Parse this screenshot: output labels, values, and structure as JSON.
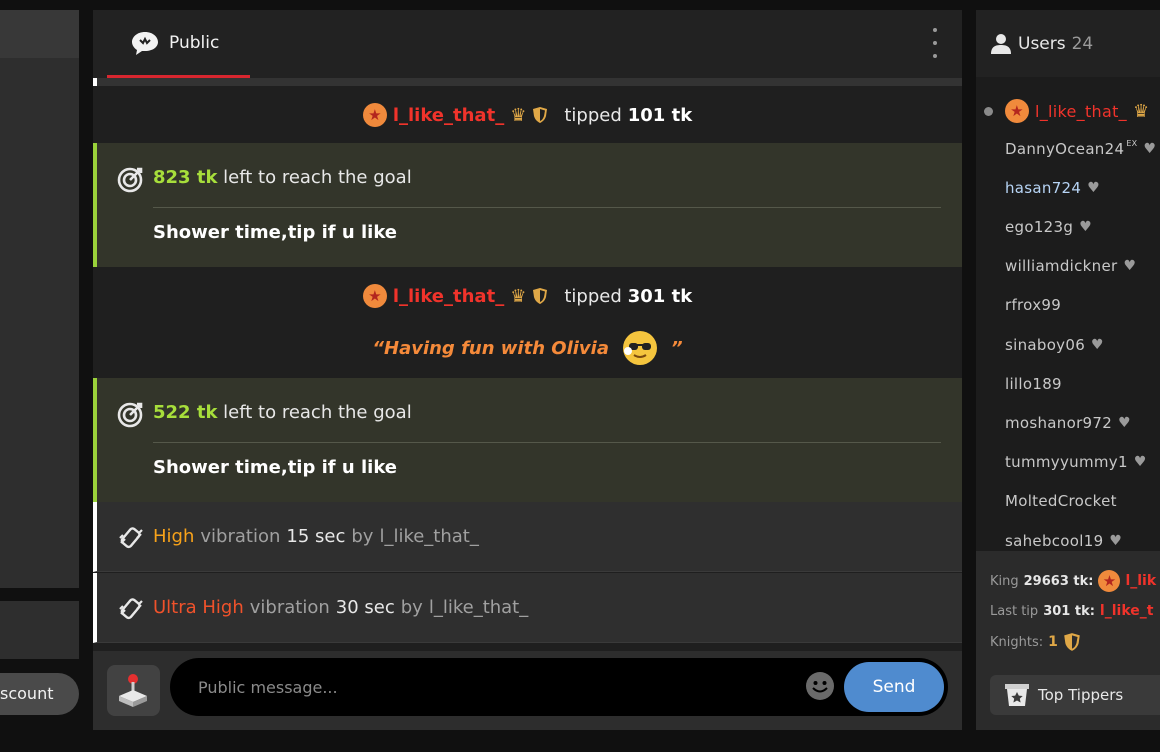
{
  "left": {
    "discount_label": "scount"
  },
  "chat": {
    "tab_label": "Public",
    "messages": {
      "tip1": {
        "user": "l_like_that_",
        "word": "tipped",
        "amount": "101 tk"
      },
      "goal1": {
        "amount": "823 tk",
        "text": "left to reach the goal",
        "subject": "Shower time,tip if u like"
      },
      "tip2": {
        "user": "l_like_that_",
        "word": "tipped",
        "amount": "301 tk"
      },
      "quote": {
        "text": "“Having fun with Olivia",
        "close": "”"
      },
      "goal2": {
        "amount": "522 tk",
        "text": "left to reach the goal",
        "subject": "Shower time,tip if u like"
      },
      "vib1": {
        "level": "High",
        "word": "vibration",
        "duration": "15 sec",
        "by": "by",
        "user": "l_like_that_"
      },
      "vib2": {
        "level": "Ultra High",
        "word": "vibration",
        "duration": "30 sec",
        "by": "by",
        "user": "l_like_that_"
      }
    },
    "composer": {
      "placeholder": "Public message...",
      "send_label": "Send"
    }
  },
  "users": {
    "title": "Users",
    "count": "24",
    "king_user": "l_like_that_",
    "list": [
      "DannyOcean24",
      "hasan724",
      "ego123g",
      "williamdickner",
      "rfrox99",
      "sinaboy06",
      "lillo189",
      "moshanor972",
      "tummyyummy1",
      "MoltedCrocket",
      "sahebcool19"
    ],
    "ex_tag": "EX",
    "stats": {
      "king_label": "King",
      "king_amount": "29663 tk:",
      "king_user": "l_lik",
      "last_label": "Last tip",
      "last_amount": "301 tk:",
      "last_user": "l_like_t",
      "knights_label": "Knights:",
      "knights_count": "1"
    },
    "top_tippers_label": "Top Tippers"
  },
  "colors": {
    "accent_red": "#d8262f",
    "goal_green": "#a7de3b",
    "send_blue": "#4f8bcf",
    "username_red": "#f0332b"
  }
}
